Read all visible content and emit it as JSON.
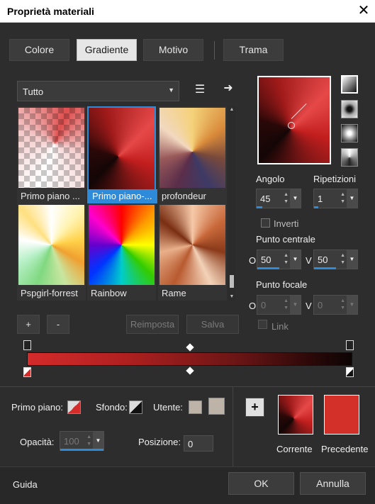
{
  "window": {
    "title": "Proprietà materiali",
    "close": "✕"
  },
  "tabs": [
    {
      "label": "Colore",
      "active": false
    },
    {
      "label": "Gradiente",
      "active": true
    },
    {
      "label": "Motivo",
      "active": false
    },
    {
      "label": "Trama",
      "active": false
    }
  ],
  "filter": {
    "value": "Tutto",
    "caret": "▼"
  },
  "icons": {
    "library": "☰",
    "export_arrow": "➜"
  },
  "gradients": [
    {
      "label": "Primo piano ...",
      "selected": false
    },
    {
      "label": "Primo piano-...",
      "selected": true
    },
    {
      "label": "profondeur",
      "selected": false
    },
    {
      "label": "Pspgirl-forrest",
      "selected": false
    },
    {
      "label": "Rainbow",
      "selected": false
    },
    {
      "label": "Rame",
      "selected": false
    }
  ],
  "scroll": {
    "up": "▲",
    "down": "▼"
  },
  "list_buttons": {
    "add": "+",
    "remove": "-",
    "reset": "Reimposta",
    "save": "Salva"
  },
  "angle": {
    "label": "Angolo",
    "value": "45",
    "fill": 0.125
  },
  "repeats": {
    "label": "Ripetizioni",
    "value": "1",
    "fill": 0.1
  },
  "invert": {
    "label": "Inverti",
    "checked": false
  },
  "center": {
    "label": "Punto centrale",
    "h_label": "O",
    "h_value": "50",
    "v_label": "V",
    "v_value": "50",
    "fill": 0.5
  },
  "focal": {
    "label": "Punto focale",
    "h_label": "O",
    "h_value": "0",
    "v_label": "V",
    "v_value": "0"
  },
  "link": {
    "label": "Link",
    "checked": false
  },
  "materials": {
    "foreground_label": "Primo piano:",
    "background_label": "Sfondo:",
    "user_label": "Utente:",
    "opacity_label": "Opacità:",
    "opacity_value": "100",
    "position_label": "Posizione:",
    "position_value": "0"
  },
  "compare": {
    "add": "+",
    "current_label": "Corrente",
    "previous_label": "Precedente"
  },
  "colors": {
    "accent": "#2e8bd9",
    "previous": "#d4302a"
  },
  "footer": {
    "help": "Guida",
    "ok": "OK",
    "cancel": "Annulla"
  }
}
